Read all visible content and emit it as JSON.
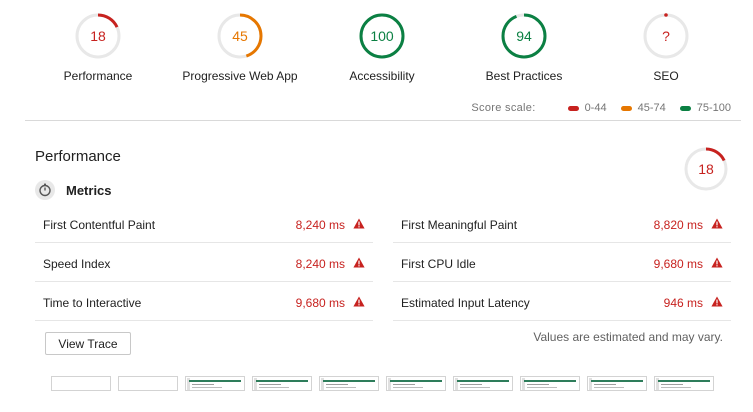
{
  "gauges": [
    {
      "label": "Performance",
      "score": "18",
      "value": 0.18,
      "color": "#c7221f"
    },
    {
      "label": "Progressive Web App",
      "score": "45",
      "value": 0.45,
      "color": "#e67700"
    },
    {
      "label": "Accessibility",
      "score": "100",
      "value": 1.0,
      "color": "#0b8043"
    },
    {
      "label": "Best Practices",
      "score": "94",
      "value": 0.94,
      "color": "#0b8043"
    },
    {
      "label": "SEO",
      "score": "?",
      "value": 0.0,
      "color": "#c7221f"
    }
  ],
  "score_scale": {
    "label": "Score scale:",
    "ranges": [
      {
        "label": "0-44",
        "color": "#c7221f"
      },
      {
        "label": "45-74",
        "color": "#e67700"
      },
      {
        "label": "75-100",
        "color": "#0b8043"
      }
    ]
  },
  "performance": {
    "title": "Performance",
    "score": "18",
    "value": 0.18,
    "color": "#c7221f",
    "metrics_title": "Metrics",
    "metrics": [
      {
        "name": "First Contentful Paint",
        "value": "8,240 ms"
      },
      {
        "name": "First Meaningful Paint",
        "value": "8,820 ms"
      },
      {
        "name": "Speed Index",
        "value": "8,240 ms"
      },
      {
        "name": "First CPU Idle",
        "value": "9,680 ms"
      },
      {
        "name": "Time to Interactive",
        "value": "9,680 ms"
      },
      {
        "name": "Estimated Input Latency",
        "value": "946 ms"
      }
    ],
    "note": "Values are estimated and may vary.",
    "view_trace_label": "View Trace"
  },
  "filmstrip": {
    "frames": 10,
    "blank_frames": 2
  },
  "icons": {
    "warning": "warning-triangle-icon",
    "metrics": "stopwatch-icon"
  }
}
